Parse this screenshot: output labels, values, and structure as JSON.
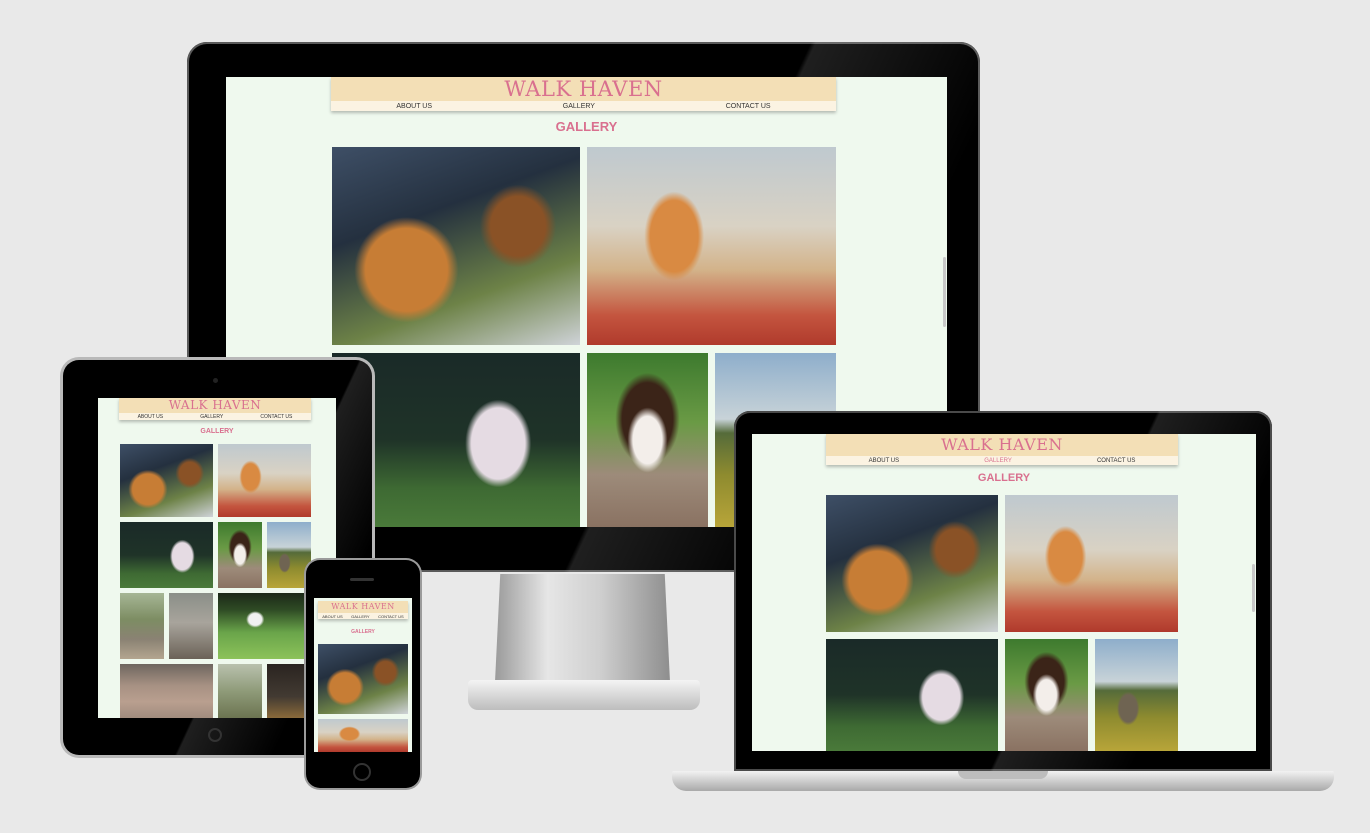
{
  "site": {
    "brand": "WALK HAVEN",
    "nav": [
      "ABOUT US",
      "GALLERY",
      "CONTACT US"
    ],
    "page_title": "GALLERY"
  },
  "colors": {
    "brand_pink": "#d9708f",
    "header_bg": "#f3dfb6",
    "nav_bg": "#fbf3e2",
    "page_bg": "#eff9ee",
    "backdrop": "#e9e9e9"
  },
  "gallery_photos": [
    "golden-retriever-with-woman",
    "shiba-inu-in-leaves",
    "fluffy-white-dog-running",
    "border-collie-puppy",
    "person-with-dog-in-field",
    "person-with-dog-in-woods",
    "person-with-dog-on-path",
    "dog-jumping-on-grass",
    "dogs-on-beach",
    "dogs-on-trail",
    "people-with-dog"
  ],
  "devices": [
    "desktop-monitor",
    "tablet",
    "smartphone",
    "laptop"
  ]
}
